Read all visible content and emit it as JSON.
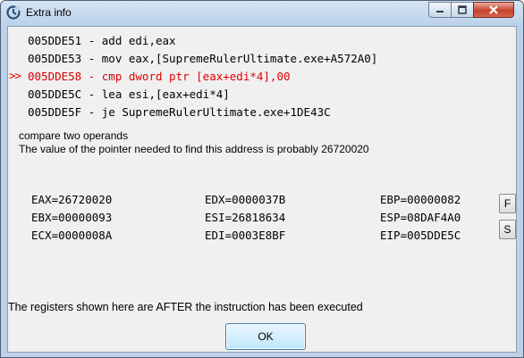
{
  "window": {
    "title": "Extra info",
    "controls": {
      "minimize": "minimize",
      "maximize": "maximize",
      "close": "close"
    }
  },
  "code": {
    "marker": ">>",
    "lines": [
      "005DDE51 - add edi,eax",
      "005DDE53 - mov eax,[SupremeRulerUltimate.exe+A572A0]",
      "005DDE58 - cmp dword ptr [eax+edi*4],00",
      "005DDE5C - lea esi,[eax+edi*4]",
      "005DDE5F - je SupremeRulerUltimate.exe+1DE43C"
    ],
    "current_index": 2,
    "current_color": "#e00000"
  },
  "description": {
    "line1": "compare two operands",
    "line2": "The value of the pointer needed to find this address is probably 26720020"
  },
  "registers": {
    "eax": "EAX=26720020",
    "ebx": "EBX=00000093",
    "ecx": "ECX=0000008A",
    "edx": "EDX=0000037B",
    "esi": "ESI=26818634",
    "edi": "EDI=0003E8BF",
    "ebp": "EBP=00000082",
    "esp": "ESP=08DAF4A0",
    "eip": "EIP=005DDE5C"
  },
  "side_buttons": {
    "f": "F",
    "s": "S"
  },
  "footnote": "The registers shown here are AFTER the instruction has been executed",
  "ok_label": "OK"
}
